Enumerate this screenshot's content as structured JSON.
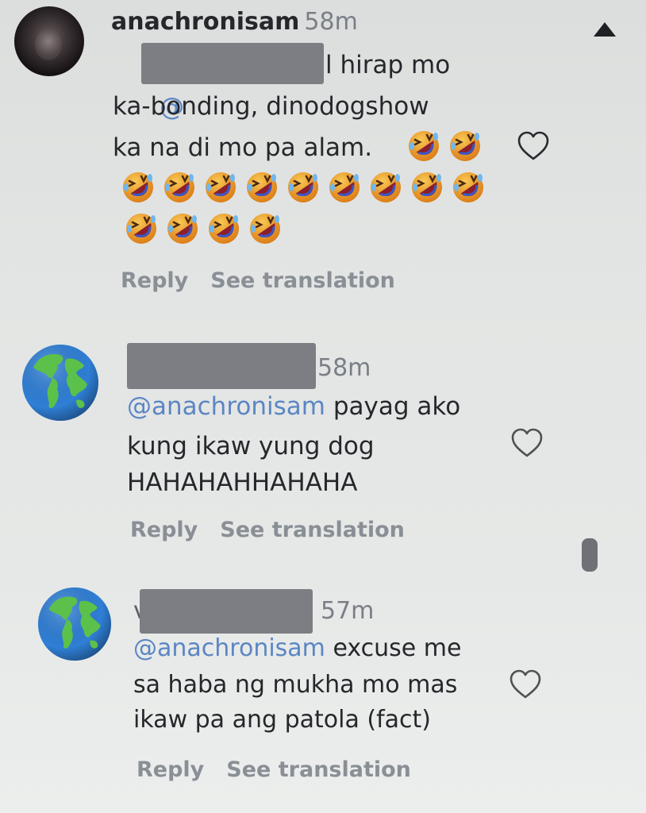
{
  "colors": {
    "mention": "#5b86c4",
    "text": "#26272b",
    "muted": "#8a8f96",
    "redaction": "#7d7e83"
  },
  "comments": [
    {
      "avatar": "dark-photo-avatar",
      "username": "anachronisam",
      "time": "58m",
      "mention": "@",
      "line1_rest": "l hirap mo",
      "line2": "ka-bonding, dinodogshow",
      "line3": "ka na di mo pa alam.",
      "emoji_icon": "rofl-emoji",
      "emoji_count": 15,
      "reply_label": "Reply",
      "translate_label": "See translation"
    },
    {
      "avatar": "globe-icon",
      "time": "58m",
      "mention": "@anachronisam",
      "line1_rest": " payag ako",
      "line2": "kung ikaw yung dog",
      "line3": "HAHAHAHHAHAHA",
      "reply_label": "Reply",
      "translate_label": "See translation"
    },
    {
      "avatar": "globe-icon",
      "username_initial": "v",
      "time": "57m",
      "mention": "@anachronisam",
      "line1_rest": " excuse me",
      "line2": "sa haba ng mukha mo mas",
      "line3": "ikaw pa ang patola (fact)",
      "reply_label": "Reply",
      "translate_label": "See translation"
    }
  ]
}
